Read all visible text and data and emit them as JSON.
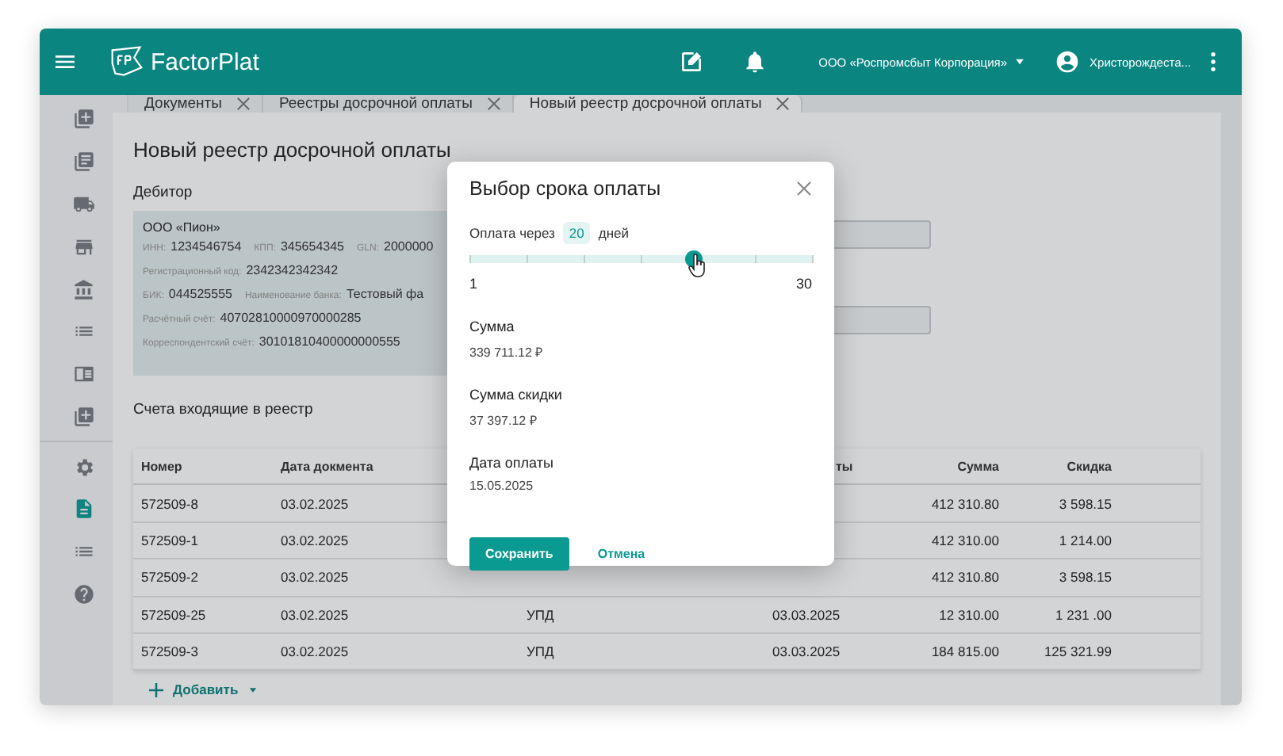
{
  "header": {
    "logo_text": "FactorPlat",
    "organization": "ООО «Роспромсбыт Корпорация»",
    "user": "Христорождеста..."
  },
  "sidebar": {
    "groups": [
      {
        "items": [
          {
            "kind": "add",
            "selected": false
          },
          {
            "kind": "docs",
            "selected": false
          },
          {
            "kind": "truck",
            "selected": false
          },
          {
            "kind": "store",
            "selected": false
          },
          {
            "kind": "bank",
            "selected": false
          },
          {
            "kind": "list",
            "selected": false
          },
          {
            "kind": "panel",
            "selected": false
          },
          {
            "kind": "add",
            "selected": false
          }
        ]
      },
      {
        "items": [
          {
            "kind": "gear",
            "selected": false
          },
          {
            "kind": "document",
            "selected": true
          },
          {
            "kind": "list",
            "selected": false
          },
          {
            "kind": "help",
            "selected": false
          }
        ]
      }
    ]
  },
  "tabs": [
    {
      "label": "Документы",
      "selected": false
    },
    {
      "label": "Реестры досрочной оплаты",
      "selected": false
    },
    {
      "label": "Новый реестр досрочной оплаты",
      "selected": true
    }
  ],
  "page": {
    "title": "Новый реестр досрочной оплаты",
    "debtor": {
      "heading": "Дебитор",
      "name": "ООО «Пион»",
      "lines": [
        [
          {
            "label": "ИНН:",
            "value": "1234546754"
          },
          {
            "label": "КПП:",
            "value": "345654345"
          },
          {
            "label": "GLN:",
            "value": "2000000"
          }
        ],
        [
          {
            "label": "Регистрационный код:",
            "value": "2342342342342"
          }
        ],
        [
          {
            "label": "БИК:",
            "value": "044525555"
          },
          {
            "label": "Наименование банка:",
            "value": "Тестовый фа"
          }
        ],
        [
          {
            "label": "Расчётный счёт:",
            "value": "40702810000970000285"
          }
        ],
        [
          {
            "label": "Корреспондентский счёт:",
            "value": "30101810400000000555"
          }
        ]
      ]
    },
    "invoices": {
      "heading": "Счета входящие в реестр",
      "columns": [
        "Номер",
        "Дата докмента",
        "",
        "ты",
        "Сумма",
        "Скидка"
      ],
      "rows": [
        [
          "572509-8",
          "03.02.2025",
          "",
          "",
          "412 310.80",
          "3 598.15"
        ],
        [
          "572509-1",
          "03.02.2025",
          "",
          "",
          "412 310.00",
          "1 214.00"
        ],
        [
          "572509-2",
          "03.02.2025",
          "",
          "",
          "412 310.80",
          "3 598.15"
        ],
        [
          "572509-25",
          "03.02.2025",
          "УПД",
          "03.03.2025",
          "12 310.00",
          "1 231 .00"
        ],
        [
          "572509-3",
          "03.02.2025",
          "УПД",
          "03.03.2025",
          "184 815.00",
          "125 321.99"
        ]
      ],
      "add_button": "Добавить"
    }
  },
  "dialog": {
    "title": "Выбор срока оплаты",
    "slider": {
      "prefix": "Оплата через",
      "value": "20",
      "suffix": "дней",
      "level": 0.655,
      "min_label": "1",
      "max_label": "30"
    },
    "fields": [
      {
        "label": "Сумма",
        "value": "339 711.12 ₽"
      },
      {
        "label": "Сумма скидки",
        "value": "37 397.12 ₽"
      },
      {
        "label": "Дата оплаты",
        "value": "15.05.2025"
      }
    ],
    "buttons": [
      {
        "label": "Сохранить",
        "kind": "primary"
      },
      {
        "label": "Отмена",
        "kind": "text"
      }
    ]
  }
}
